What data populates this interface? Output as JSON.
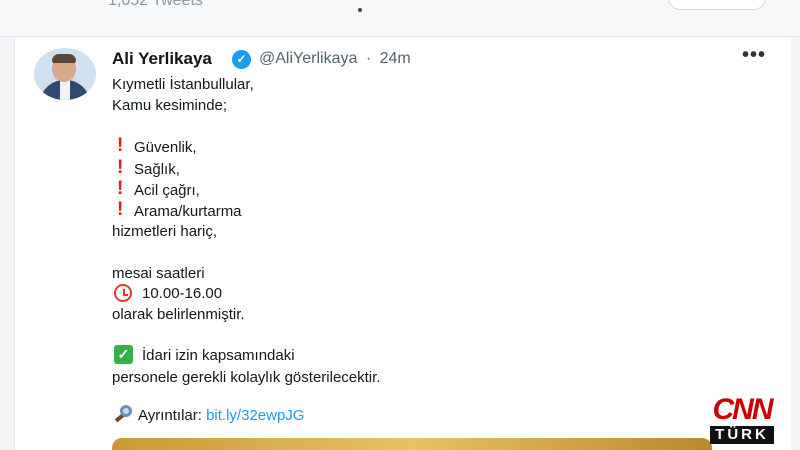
{
  "top": {
    "tweet_count": "1,052 Tweets"
  },
  "tweet": {
    "name": "Ali Yerlikaya",
    "handle": "@AliYerlikaya",
    "separator": "·",
    "time": "24m",
    "more": "•••",
    "lines": [
      "Kıymetli İstanbullular,",
      "Kamu kesiminde;",
      "Güvenlik,",
      "Sağlık,",
      "Acil çağrı,",
      "Arama/kurtarma",
      "hizmetleri hariç,",
      "mesai saatleri",
      "10.00-16.00",
      "olarak belirlenmiştir.",
      "İdari izin kapsamındaki",
      "personele gerekli kolaylık gösterilecektir."
    ],
    "details_label": "Ayrıntılar:",
    "details_link": "bit.ly/32ewpJG",
    "icons": [
      "exclamation-icon",
      "alarm-clock-icon",
      "check-mark-icon",
      "magnifier-icon",
      "verified-badge-icon"
    ]
  },
  "overlay": {
    "logo_top": "CNN",
    "logo_bottom": "TÜRK"
  },
  "colors": {
    "accent": "#1d9bf0",
    "exclamation": "#d91f26",
    "check": "#33b24a"
  }
}
